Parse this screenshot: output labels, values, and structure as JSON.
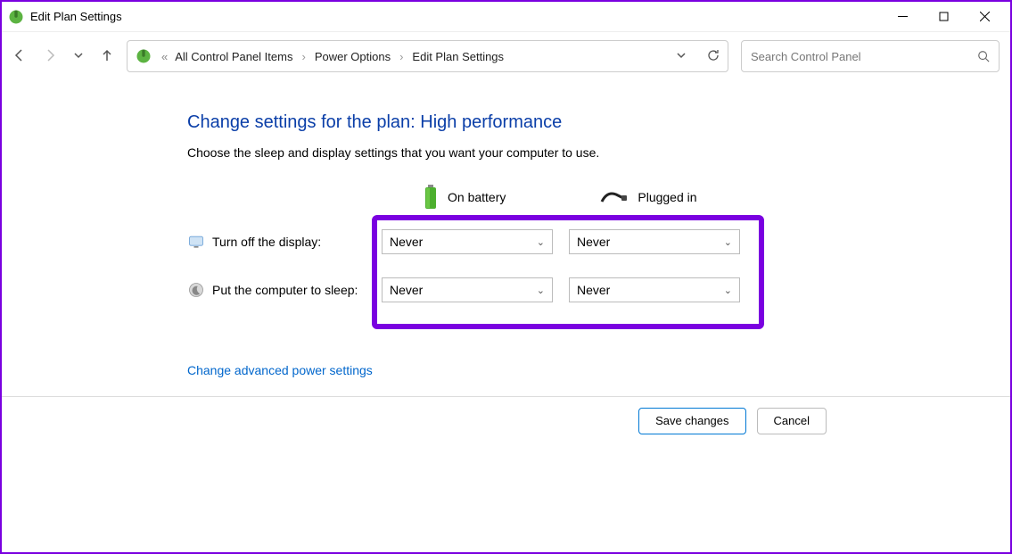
{
  "window": {
    "title": "Edit Plan Settings"
  },
  "breadcrumb": {
    "item1": "All Control Panel Items",
    "item2": "Power Options",
    "item3": "Edit Plan Settings"
  },
  "search": {
    "placeholder": "Search Control Panel"
  },
  "page": {
    "title": "Change settings for the plan: High performance",
    "subtext": "Choose the sleep and display settings that you want your computer to use."
  },
  "columns": {
    "battery": "On battery",
    "plugged": "Plugged in"
  },
  "rows": {
    "display": {
      "label": "Turn off the display:",
      "battery": "Never",
      "plugged": "Never"
    },
    "sleep": {
      "label": "Put the computer to sleep:",
      "battery": "Never",
      "plugged": "Never"
    }
  },
  "link": {
    "advanced": "Change advanced power settings"
  },
  "buttons": {
    "save": "Save changes",
    "cancel": "Cancel"
  }
}
